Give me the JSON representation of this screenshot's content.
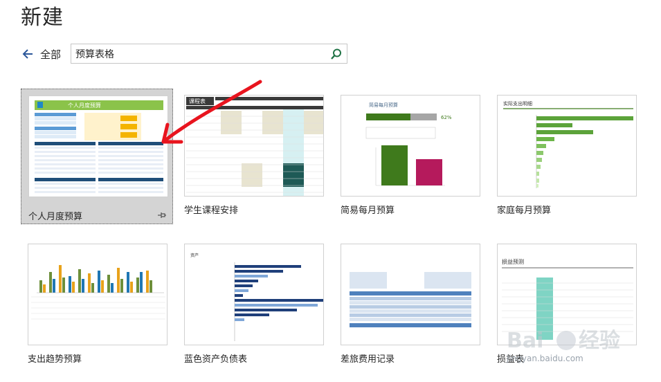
{
  "page": {
    "title": "新建"
  },
  "nav": {
    "back_label": "全部"
  },
  "search": {
    "value": "预算表格"
  },
  "templates": [
    {
      "label": "个人月度预算",
      "selected": true,
      "thumb_title": "个人月度预算"
    },
    {
      "label": "学生课程安排",
      "thumb_title": "课程表"
    },
    {
      "label": "简易每月预算",
      "thumb_title": "简易每月预算",
      "percent": "62%"
    },
    {
      "label": "家庭每月预算",
      "thumb_title": "实际支出明细"
    },
    {
      "label": "支出趋势预算"
    },
    {
      "label": "蓝色资产负债表",
      "thumb_title": "资产"
    },
    {
      "label": "差旅费用记录"
    },
    {
      "label": "损益表",
      "thumb_title": "损益预测"
    }
  ],
  "watermark": {
    "url": "jingyan.baidu.com"
  },
  "colors": {
    "accent": "#217346",
    "arrow": "#e8141e",
    "back_arrow": "#2b579a"
  }
}
